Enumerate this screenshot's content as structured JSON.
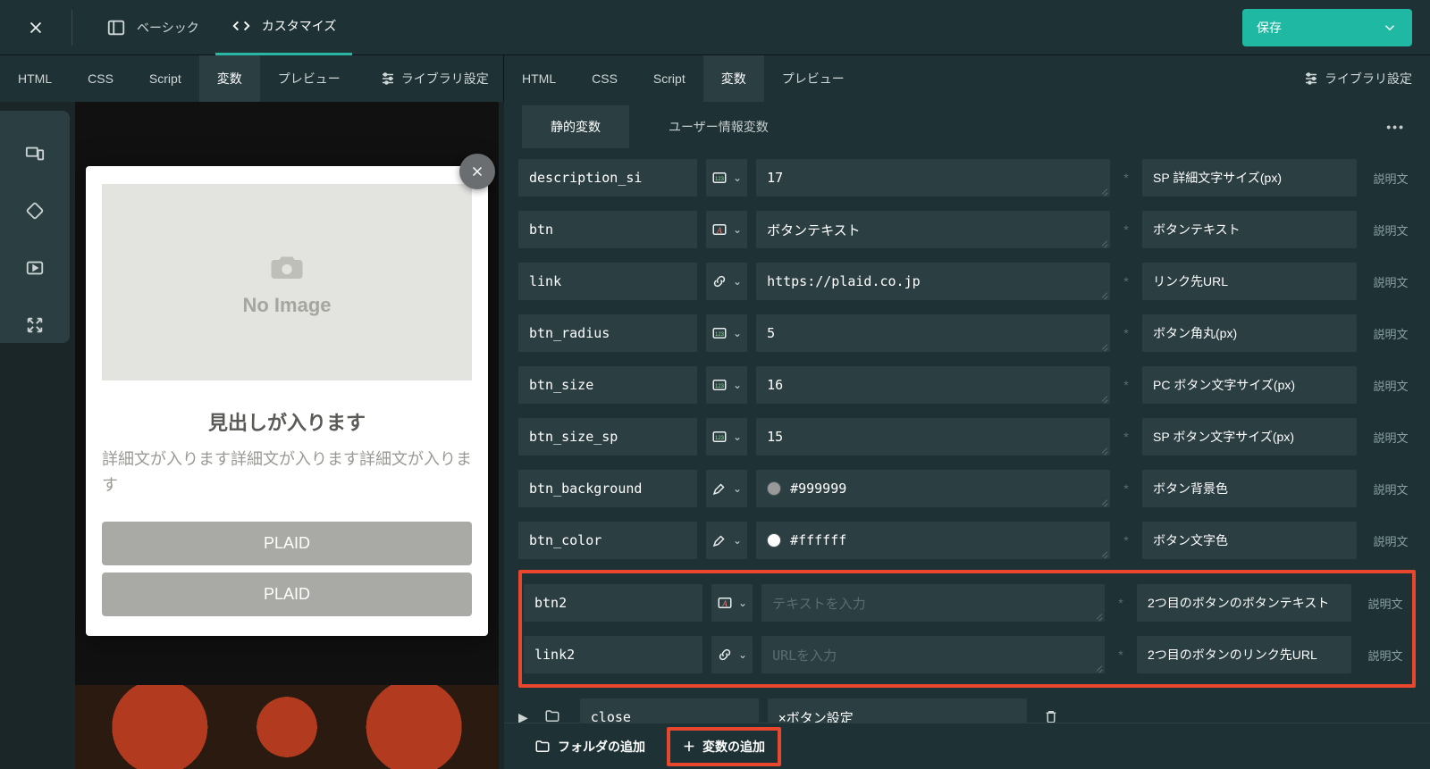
{
  "topbar": {
    "tabs": [
      {
        "label": "ベーシック",
        "active": false
      },
      {
        "label": "カスタマイズ",
        "active": true
      }
    ],
    "save_label": "保存"
  },
  "subtabs": {
    "left": [
      {
        "key": "html",
        "label": "HTML"
      },
      {
        "key": "css",
        "label": "CSS"
      },
      {
        "key": "script",
        "label": "Script"
      },
      {
        "key": "vars",
        "label": "変数",
        "active": true
      },
      {
        "key": "preview",
        "label": "プレビュー"
      }
    ],
    "left_lib": "ライブラリ設定",
    "right": [
      {
        "key": "html",
        "label": "HTML"
      },
      {
        "key": "css",
        "label": "CSS"
      },
      {
        "key": "script",
        "label": "Script"
      },
      {
        "key": "vars",
        "label": "変数",
        "active": true
      },
      {
        "key": "preview",
        "label": "プレビュー"
      }
    ],
    "right_lib": "ライブラリ設定"
  },
  "preview": {
    "heading": "見出しが入ります",
    "description": "詳細文が入ります詳細文が入ります詳細文が入ります",
    "no_image": "No Image",
    "buttons": [
      "PLAID",
      "PLAID"
    ]
  },
  "right_panel": {
    "inner_tabs": {
      "static": "静的変数",
      "user": "ユーザー情報変数"
    },
    "vars": [
      {
        "name": "description_si",
        "type": "number",
        "value": "17",
        "label": "SP 詳細文字サイズ(px)",
        "desc": "説明文"
      },
      {
        "name": "btn",
        "type": "text",
        "value": "ボタンテキスト",
        "label": "ボタンテキスト",
        "desc": "説明文"
      },
      {
        "name": "link",
        "type": "link",
        "value": "https://plaid.co.jp",
        "label": "リンク先URL",
        "desc": "説明文"
      },
      {
        "name": "btn_radius",
        "type": "number",
        "value": "5",
        "label": "ボタン角丸(px)",
        "desc": "説明文"
      },
      {
        "name": "btn_size",
        "type": "number",
        "value": "16",
        "label": "PC ボタン文字サイズ(px)",
        "desc": "説明文"
      },
      {
        "name": "btn_size_sp",
        "type": "number",
        "value": "15",
        "label": "SP ボタン文字サイズ(px)",
        "desc": "説明文"
      },
      {
        "name": "btn_background",
        "type": "color",
        "value": "#999999",
        "swatch": "#999999",
        "label": "ボタン背景色",
        "desc": "説明文"
      },
      {
        "name": "btn_color",
        "type": "color",
        "value": "#ffffff",
        "swatch": "#ffffff",
        "label": "ボタン文字色",
        "desc": "説明文"
      },
      {
        "name": "btn2",
        "type": "text",
        "value": "",
        "placeholder": "テキストを入力",
        "label": "2つ目のボタンのボタンテキスト",
        "desc": "説明文",
        "hl": true
      },
      {
        "name": "link2",
        "type": "link",
        "value": "",
        "placeholder": "URLを入力",
        "label": "2つ目のボタンのリンク先URL",
        "desc": "説明文",
        "hl": true
      }
    ],
    "folder": {
      "name": "close",
      "value": "×ボタン設定"
    },
    "bottom": {
      "add_folder": "フォルダの追加",
      "add_var": "変数の追加"
    }
  },
  "icons": {
    "number": "123",
    "text": "A",
    "link": "link",
    "color": "dropper"
  }
}
